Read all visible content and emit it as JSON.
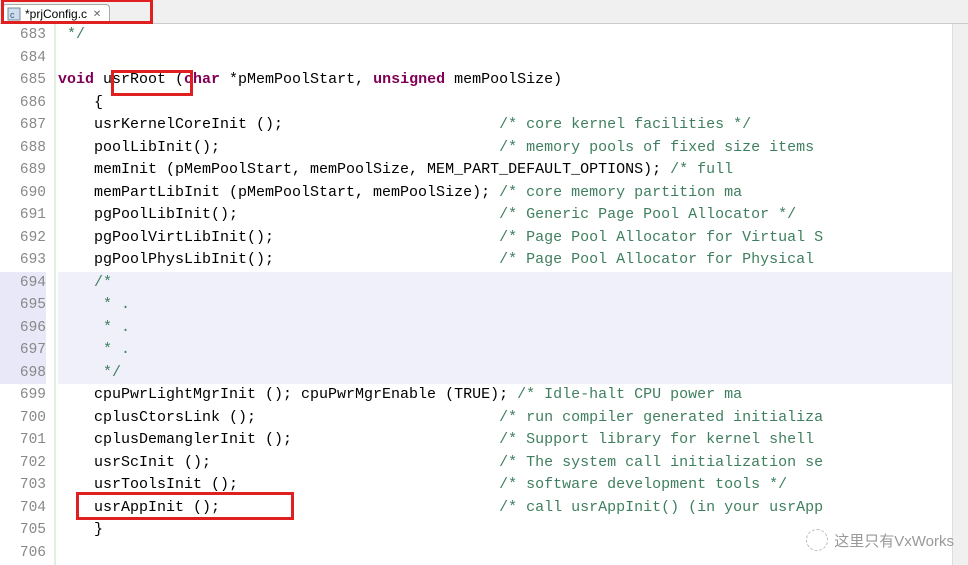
{
  "tab": {
    "title": "*prjConfig.c"
  },
  "gutter": {
    "start": 683,
    "highlight_start": 694,
    "highlight_end": 698
  },
  "code": {
    "l683": " */",
    "l684": "",
    "l685_pre": "void",
    "l685_fn": " usrRoot ",
    "l685_lparen": "(",
    "l685_kw2": "char",
    "l685_mid": " *pMemPoolStart, ",
    "l685_kw3": "unsigned",
    "l685_end": " memPoolSize)",
    "l686": "    {",
    "l687_code": "    usrKernelCoreInit ();",
    "l687_cm": "/* core kernel facilities */",
    "l688_code": "    poolLibInit();",
    "l688_cm": "/* memory pools of fixed size items ",
    "l689_code": "    memInit (pMemPoolStart, memPoolSize, MEM_PART_DEFAULT_OPTIONS); ",
    "l689_cm": "/* full ",
    "l690_code": "    memPartLibInit (pMemPoolStart, memPoolSize); ",
    "l690_cm": "/* core memory partition ma",
    "l691_code": "    pgPoolLibInit();",
    "l691_cm": "/* Generic Page Pool Allocator */",
    "l692_code": "    pgPoolVirtLibInit();",
    "l692_cm": "/* Page Pool Allocator for Virtual S",
    "l693_code": "    pgPoolPhysLibInit();",
    "l693_cm": "/* Page Pool Allocator for Physical ",
    "l694": "    /*",
    "l695": "     * .",
    "l696": "     * .",
    "l697": "     * .",
    "l698": "     */",
    "l699_code": "    cpuPwrLightMgrInit (); cpuPwrMgrEnable (TRUE); ",
    "l699_cm": "/* Idle-halt CPU power ma",
    "l700_code": "    cplusCtorsLink ();",
    "l700_cm": "/* run compiler generated initializa",
    "l701_code": "    cplusDemanglerInit ();",
    "l701_cm": "/* Support library for kernel shell ",
    "l702_code": "    usrScInit ();",
    "l702_cm": "/* The system call initialization se",
    "l703_code": "    usrToolsInit ();",
    "l703_cm": "/* software development tools */",
    "l704_code": "    usrAppInit ();",
    "l704_cm": "/* call usrAppInit() (in your usrApp",
    "l705": "    }",
    "l706": ""
  },
  "comment_col": 49,
  "watermark": "这里只有VxWorks"
}
